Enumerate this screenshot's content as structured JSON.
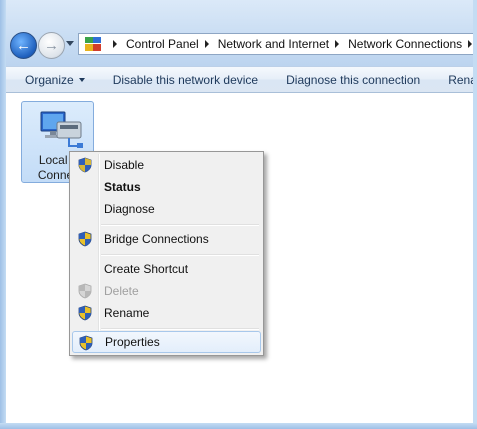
{
  "address_bar": {
    "breadcrumbs": [
      "Control Panel",
      "Network and Internet",
      "Network Connections"
    ]
  },
  "command_bar": {
    "organize_label": "Organize",
    "disable_label": "Disable this network device",
    "diagnose_label": "Diagnose this connection",
    "rename_label": "Rena"
  },
  "connection": {
    "label_line1": "Local A",
    "label_line2": "Connec"
  },
  "context_menu": {
    "items": [
      {
        "label": "Disable",
        "icon": "uac-shield-icon"
      },
      {
        "label": "Status",
        "default": true
      },
      {
        "label": "Diagnose"
      },
      {
        "label": "Bridge Connections",
        "icon": "uac-shield-icon"
      },
      {
        "label": "Create Shortcut"
      },
      {
        "label": "Delete",
        "icon": "uac-shield-icon",
        "disabled": true
      },
      {
        "label": "Rename",
        "icon": "uac-shield-icon"
      },
      {
        "label": "Properties",
        "icon": "uac-shield-icon",
        "highlighted": true
      }
    ]
  },
  "colors": {
    "accent": "#1e395b",
    "shield_blue": "#2f5fb8",
    "shield_yellow": "#e9c12a",
    "highlight_border": "#a8c8eb"
  }
}
